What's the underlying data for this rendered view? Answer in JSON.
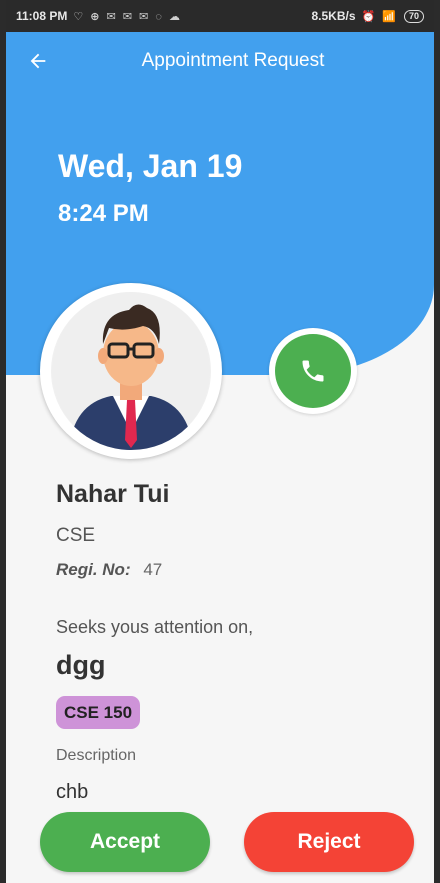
{
  "status_bar": {
    "time": "11:08 PM",
    "notif_icons": "♡ ⊕ ✉ ✉ ✉ ◌ ☁",
    "net_speed": "8.5KB/s",
    "right_icons": "⏰ 📶",
    "battery": "70"
  },
  "header": {
    "title": "Appointment Request",
    "back_icon": "arrow-left-icon"
  },
  "appointment": {
    "date": "Wed, Jan 19",
    "time": "8:24 PM"
  },
  "student": {
    "name": "Nahar Tui",
    "department": "CSE",
    "regi_label": "Regi. No:",
    "regi_value": "47"
  },
  "request": {
    "seeks_text": "Seeks yous attention on,",
    "topic": "dgg",
    "course": "CSE 150",
    "description_label": "Description",
    "description": "chb"
  },
  "actions": {
    "accept": "Accept",
    "reject": "Reject"
  },
  "colors": {
    "header_blue": "#42a0ee",
    "accept_green": "#4caf50",
    "reject_red": "#f44336",
    "chip_purple": "#ce93d8"
  }
}
